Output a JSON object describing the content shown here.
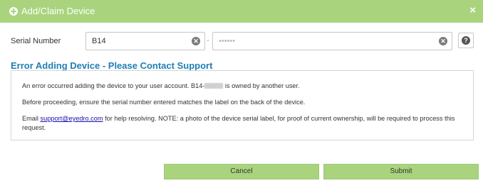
{
  "dialog": {
    "title": "Add/Claim Device",
    "close_symbol": "×"
  },
  "serial": {
    "label": "Serial Number",
    "prefix_value": "B14",
    "separator": "-",
    "suffix_value": "••••••",
    "clear_symbol": "✕",
    "help_symbol": "?"
  },
  "error": {
    "title": "Error Adding Device - Please Contact Support",
    "line1_before": "An error occurred adding the device to your user account. B14-",
    "line1_after": " is owned by another user.",
    "line2": "Before proceeding, ensure the serial number entered matches the label on the back of the device.",
    "line3_before": "Email ",
    "line3_link": "support@eyedro.com",
    "line3_after": " for help resolving. NOTE: a photo of the device serial label, for proof of current ownership, will be required to process this request."
  },
  "buttons": {
    "cancel": "Cancel",
    "submit": "Submit"
  },
  "colors": {
    "header_bg": "#a9d47d",
    "error_title": "#1f7fb5",
    "link": "#1a0dab"
  },
  "icons": {
    "header": "plus-circle-icon",
    "close": "close-icon",
    "clear": "clear-circle-icon",
    "help": "question-circle-icon"
  }
}
